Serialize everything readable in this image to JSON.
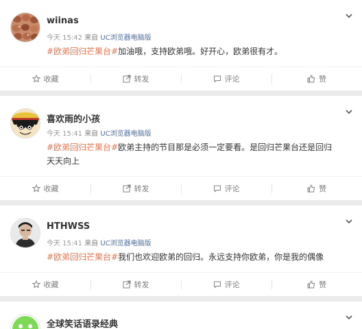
{
  "actions": {
    "collect": "收藏",
    "repost": "转发",
    "comment": "评论",
    "like": "赞"
  },
  "posts": [
    {
      "user": "wiinas",
      "time": "今天 15:42",
      "via": "来自",
      "source": "UC浏览器电脑版",
      "topic": "#欧弟回归芒果台#",
      "text": "加油哦，支持欧弟哦。好开心，欧弟很有才。",
      "avatar": "nuts-avatar"
    },
    {
      "user": "喜欢雨的小孩",
      "time": "今天 15:41",
      "via": "来自",
      "source": "UC浏览器电脑版",
      "topic": "#欧弟回归芒果台#",
      "text": "欧弟主持的节目那是必须一定要看。是回归芒果台还是回归天天向上",
      "avatar": "cartoon-pirate-avatar"
    },
    {
      "user": "HTHWSS",
      "time": "今天 15:41",
      "via": "来自",
      "source": "UC浏览器电脑版",
      "topic": "#欧弟回归芒果台#",
      "text": "我们也欢迎欧弟的回归。永远支持你欧弟，你是我的偶像",
      "avatar": "person-photo-avatar"
    },
    {
      "user": "全球笑话语录经典",
      "avatar": "green-smile-avatar"
    }
  ],
  "colors": {
    "topic": "#eb7350",
    "source": "#4e6ea3",
    "meta": "#808080",
    "background": "#ebebeb"
  }
}
